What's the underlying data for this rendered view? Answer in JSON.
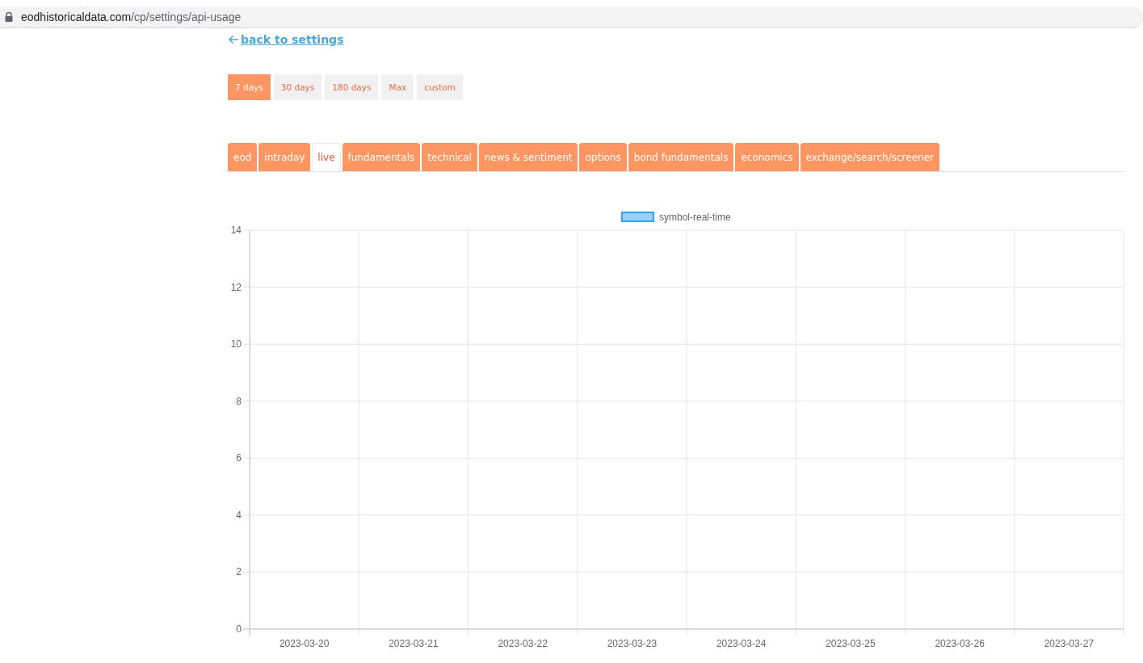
{
  "address_bar": {
    "url_host": "eodhistoricaldata.com",
    "url_path": "/cp/settings/api-usage"
  },
  "back_link": {
    "label": "back to settings"
  },
  "ranges": [
    {
      "label": "7 days",
      "selected": true
    },
    {
      "label": "30 days",
      "selected": false
    },
    {
      "label": "180 days",
      "selected": false
    },
    {
      "label": "Max",
      "selected": false
    },
    {
      "label": "custom",
      "selected": false
    }
  ],
  "tabs": [
    {
      "label": "eod",
      "selected": false
    },
    {
      "label": "intraday",
      "selected": false
    },
    {
      "label": "live",
      "selected": true
    },
    {
      "label": "fundamentals",
      "selected": false
    },
    {
      "label": "technical",
      "selected": false
    },
    {
      "label": "news & sentiment",
      "selected": false
    },
    {
      "label": "options",
      "selected": false
    },
    {
      "label": "bond fundamentals",
      "selected": false
    },
    {
      "label": "economics",
      "selected": false
    },
    {
      "label": "exchange/search/screener",
      "selected": false
    }
  ],
  "chart": {
    "chart_data": {
      "type": "bar",
      "categories": [
        "2023-03-20",
        "2023-03-21",
        "2023-03-22",
        "2023-03-23",
        "2023-03-24",
        "2023-03-25",
        "2023-03-26",
        "2023-03-27"
      ],
      "series": [
        {
          "name": "symbol-real-time",
          "color": "#36a2eb",
          "values": [
            0,
            0,
            0,
            0,
            0,
            0,
            0,
            0
          ]
        }
      ],
      "grid": true,
      "ylim": [
        0,
        14
      ],
      "yticks": [
        0,
        2,
        4,
        6,
        8,
        10,
        12,
        14
      ]
    }
  }
}
